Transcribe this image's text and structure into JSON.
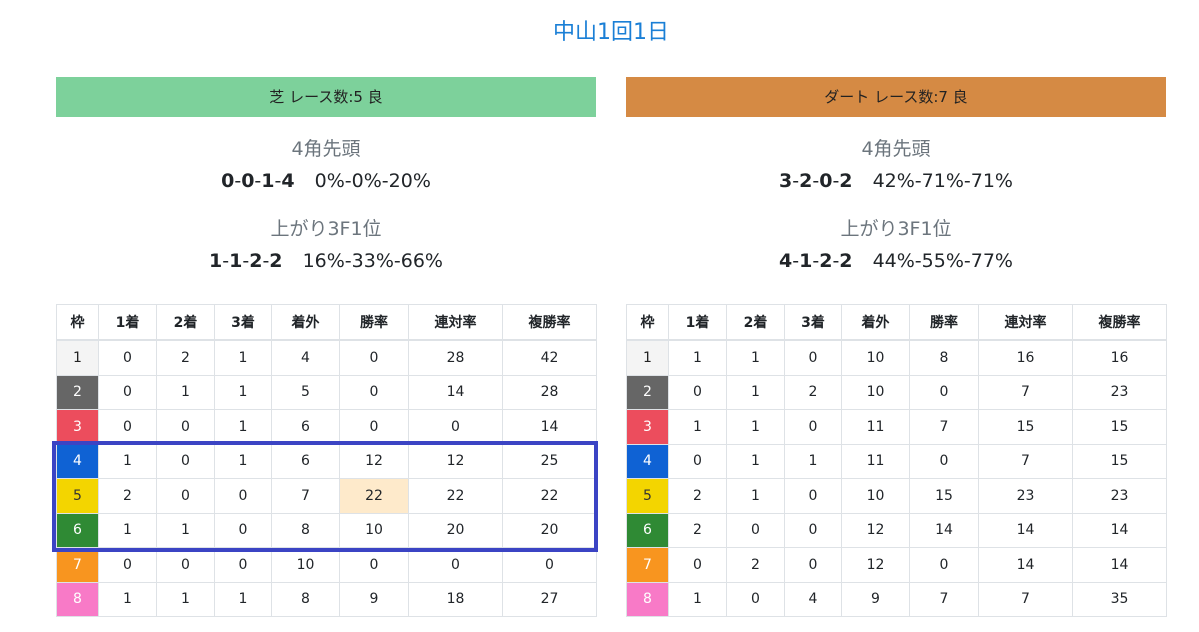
{
  "page_title": "中山1回1日",
  "colors": {
    "title": "#1a7fd6",
    "turf_header": "#7dd19b",
    "dirt_header": "#d58a44",
    "highlight_box": "#3b44c4",
    "highlight_cell": "#feeacb"
  },
  "columns": [
    "枠",
    "1着",
    "2着",
    "3着",
    "着外",
    "勝率",
    "連対率",
    "複勝率"
  ],
  "waku_colors": [
    {
      "bg": "#f4f4f4",
      "fg": "#222222"
    },
    {
      "bg": "#666666",
      "fg": "#ffffff"
    },
    {
      "bg": "#ec4d5d",
      "fg": "#ffffff"
    },
    {
      "bg": "#0f62d4",
      "fg": "#ffffff"
    },
    {
      "bg": "#f3d500",
      "fg": "#333333"
    },
    {
      "bg": "#2f8a34",
      "fg": "#ffffff"
    },
    {
      "bg": "#f8951f",
      "fg": "#ffffff"
    },
    {
      "bg": "#f87ac7",
      "fg": "#ffffff"
    }
  ],
  "turf": {
    "header": "芝 レース数:5 良",
    "corner_title": "4角先頭",
    "corner_record": [
      "0",
      "0",
      "1",
      "4"
    ],
    "corner_rates": "0%-0%-20%",
    "last3f_title": "上がり3F1位",
    "last3f_record": [
      "1",
      "1",
      "2",
      "2"
    ],
    "last3f_rates": "16%-33%-66%",
    "rows": [
      [
        "1",
        "0",
        "2",
        "1",
        "4",
        "0",
        "28",
        "42"
      ],
      [
        "2",
        "0",
        "1",
        "1",
        "5",
        "0",
        "14",
        "28"
      ],
      [
        "3",
        "0",
        "0",
        "1",
        "6",
        "0",
        "0",
        "14"
      ],
      [
        "4",
        "1",
        "0",
        "1",
        "6",
        "12",
        "12",
        "25"
      ],
      [
        "5",
        "2",
        "0",
        "0",
        "7",
        "22",
        "22",
        "22"
      ],
      [
        "6",
        "1",
        "1",
        "0",
        "8",
        "10",
        "20",
        "20"
      ],
      [
        "7",
        "0",
        "0",
        "0",
        "10",
        "0",
        "0",
        "0"
      ],
      [
        "8",
        "1",
        "1",
        "1",
        "8",
        "9",
        "18",
        "27"
      ]
    ]
  },
  "dirt": {
    "header": "ダート レース数:7 良",
    "corner_title": "4角先頭",
    "corner_record": [
      "3",
      "2",
      "0",
      "2"
    ],
    "corner_rates": "42%-71%-71%",
    "last3f_title": "上がり3F1位",
    "last3f_record": [
      "4",
      "1",
      "2",
      "2"
    ],
    "last3f_rates": "44%-55%-77%",
    "rows": [
      [
        "1",
        "1",
        "1",
        "0",
        "10",
        "8",
        "16",
        "16"
      ],
      [
        "2",
        "0",
        "1",
        "2",
        "10",
        "0",
        "7",
        "23"
      ],
      [
        "3",
        "1",
        "1",
        "0",
        "11",
        "7",
        "15",
        "15"
      ],
      [
        "4",
        "0",
        "1",
        "1",
        "11",
        "0",
        "7",
        "15"
      ],
      [
        "5",
        "2",
        "1",
        "0",
        "10",
        "15",
        "23",
        "23"
      ],
      [
        "6",
        "2",
        "0",
        "0",
        "12",
        "14",
        "14",
        "14"
      ],
      [
        "7",
        "0",
        "2",
        "0",
        "12",
        "0",
        "14",
        "14"
      ],
      [
        "8",
        "1",
        "0",
        "4",
        "9",
        "7",
        "7",
        "35"
      ]
    ]
  }
}
